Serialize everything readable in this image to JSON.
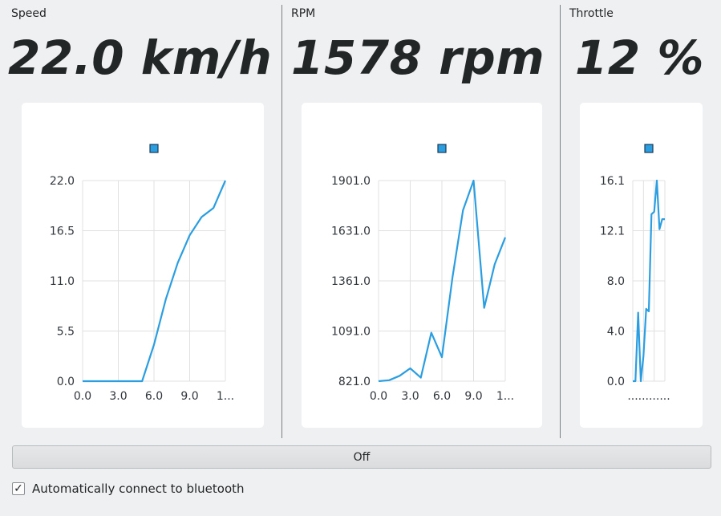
{
  "colors": {
    "line": "#2a9ee0",
    "grid": "#e0e0e0",
    "background": "#eff0f1"
  },
  "panels": [
    {
      "label": "Speed",
      "readout": "22.0 km/h"
    },
    {
      "label": "RPM",
      "readout": "1578 rpm"
    },
    {
      "label": "Throttle",
      "readout": "12 %"
    }
  ],
  "chart_data": [
    {
      "type": "line",
      "title": "",
      "xlabel": "",
      "ylabel": "",
      "ylim": [
        0,
        22
      ],
      "xlim": [
        0,
        12
      ],
      "y_ticks": [
        "0.0",
        "5.5",
        "11.0",
        "16.5",
        "22.0"
      ],
      "x_ticks": [
        "0.0",
        "3.0",
        "6.0",
        "9.0",
        "1..."
      ],
      "grid": true,
      "legend": "top-center",
      "series": [
        {
          "x": [
            0,
            1,
            2,
            3,
            4,
            5,
            6,
            7,
            8,
            9,
            10,
            11,
            12
          ],
          "y": [
            0,
            0,
            0,
            0,
            0,
            0,
            4,
            9,
            13,
            16,
            18,
            19,
            22
          ]
        }
      ]
    },
    {
      "type": "line",
      "title": "",
      "xlabel": "",
      "ylabel": "",
      "ylim": [
        821,
        1901
      ],
      "xlim": [
        0,
        12
      ],
      "y_ticks": [
        "821.0",
        "1091.0",
        "1361.0",
        "1631.0",
        "1901.0"
      ],
      "x_ticks": [
        "0.0",
        "3.0",
        "6.0",
        "9.0",
        "1..."
      ],
      "grid": true,
      "legend": "top-center",
      "series": [
        {
          "x": [
            0,
            1,
            2,
            3,
            4,
            5,
            6,
            7,
            8,
            9,
            10,
            11,
            12
          ],
          "y": [
            821,
            826,
            850,
            890,
            840,
            1082,
            950,
            1380,
            1741,
            1901,
            1216,
            1450,
            1595
          ]
        }
      ]
    },
    {
      "type": "line",
      "title": "",
      "xlabel": "",
      "ylabel": "",
      "ylim": [
        0,
        16.1
      ],
      "xlim": [
        0,
        12
      ],
      "y_ticks": [
        "0.0",
        "4.0",
        "8.0",
        "12.1",
        "16.1"
      ],
      "x_ticks": [
        "...",
        "...",
        "...",
        "..."
      ],
      "grid": true,
      "legend": "top-center",
      "series": [
        {
          "x": [
            0,
            1,
            2,
            3,
            4,
            5,
            6,
            7,
            8,
            9,
            10,
            11,
            12
          ],
          "y": [
            0,
            0,
            5.5,
            0,
            2,
            5.8,
            5.6,
            13.4,
            13.6,
            16.1,
            12.2,
            13,
            13
          ]
        }
      ]
    }
  ],
  "controls": {
    "toggle_label": "Off",
    "checkbox_checked": true,
    "checkbox_mark": "✓",
    "checkbox_label": "Automatically connect to bluetooth"
  }
}
